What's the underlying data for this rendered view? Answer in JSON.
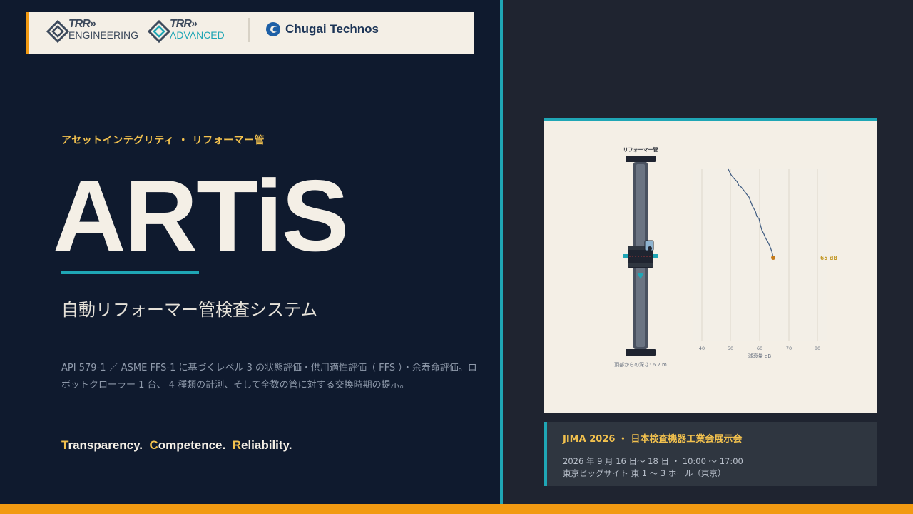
{
  "logos": {
    "trr_mark": "TRR»",
    "engineering_label": "ENGINEERING",
    "advanced_label": "ADVANCED",
    "chugai_label": "Chugai Technos"
  },
  "hero": {
    "eyebrow": "アセットインテグリティ ・ リフォーマー管",
    "title": "ARTiS",
    "subtitle": "自動リフォーマー管検査システム",
    "description": "API 579-1 ／ ASME FFS-1 に基づくレベル 3 の状態評価・供用適性評価（ FFS ）・余寿命評価。ロボットクローラー 1 台、 4 種類の計測、そして全数の管に対する交換時期の提示。",
    "tagline": [
      {
        "initial": "T",
        "rest": "ransparency."
      },
      {
        "initial": "C",
        "rest": "ompetence."
      },
      {
        "initial": "R",
        "rest": "eliability."
      }
    ]
  },
  "diagram": {
    "tube_label": "リフォーマー管",
    "depth_label": "頂部からの深さ: 6.2 m",
    "readout_label": "65 dB",
    "x_axis_label": "減衰量 dB",
    "x_ticks": [
      "40",
      "50",
      "60",
      "70",
      "80"
    ]
  },
  "event": {
    "title": "JIMA 2026 ・ 日本検査機器工業会展示会",
    "date_line": "2026 年 9 月 16 日〜 18 日 ・ 10:00 〜 17:00",
    "venue_line": "東京ビッグサイト 東 1 〜 3 ホール（東京）"
  },
  "colors": {
    "navy": "#0f1a2e",
    "teal": "#1fa6b5",
    "orange": "#f29a12",
    "gold": "#f2c14e",
    "cream": "#f4efe6"
  }
}
